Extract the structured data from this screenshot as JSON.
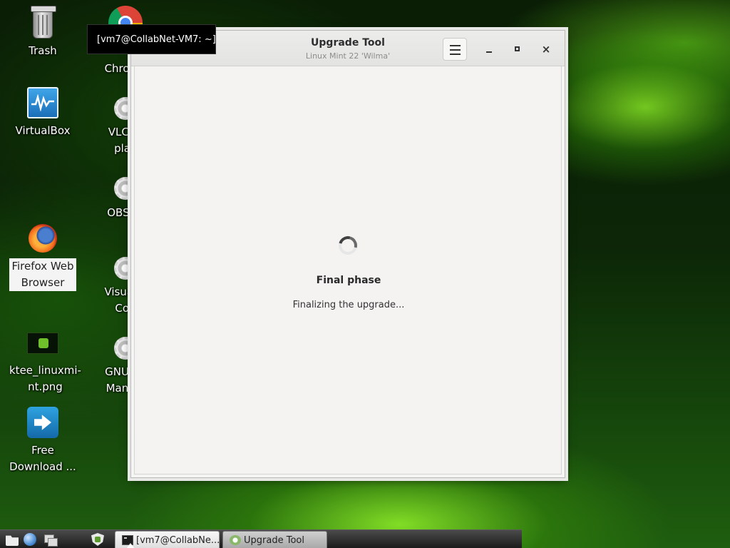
{
  "desktop": {
    "icons": [
      {
        "id": "trash",
        "label": "Trash",
        "icon": "trash-icon"
      },
      {
        "id": "chrome",
        "label": "Chrome",
        "icon": "chrome-icon"
      },
      {
        "id": "virtualbox",
        "label": "VirtualBox",
        "icon": "virtualbox-icon"
      },
      {
        "id": "vlc",
        "label": "VLC m\nplay",
        "icon": "gear-icon"
      },
      {
        "id": "obs",
        "label": "OBS St",
        "icon": "gear-icon"
      },
      {
        "id": "firefox",
        "label": "Firefox Web\nBrowser",
        "icon": "firefox-icon"
      },
      {
        "id": "vscode",
        "label": "Visual S\nCod",
        "icon": "gear-icon"
      },
      {
        "id": "ktee",
        "label": "ktee_linuxmi-\nnt.png",
        "icon": "image-file-icon"
      },
      {
        "id": "gimp",
        "label": "GNU Im\nManipu",
        "icon": "gear-icon"
      },
      {
        "id": "fdm",
        "label": "Free\nDownload ...",
        "icon": "free-download-manager-icon"
      }
    ],
    "tooltip": "[vm7@CollabNet-VM7: ~]"
  },
  "window": {
    "title": "Upgrade Tool",
    "subtitle": "Linux Mint 22 'Wilma'",
    "close_glyph": "×",
    "phase_title": "Final phase",
    "phase_message": "Finalizing the upgrade..."
  },
  "taskbar": {
    "tasks": [
      {
        "label": "[vm7@CollabNe...",
        "active": true
      },
      {
        "label": "Upgrade Tool",
        "active": false
      }
    ]
  },
  "colors": {
    "desktop_green": "#1f5e0f",
    "window_bg": "#f5f5f4",
    "spinner": "#404040"
  }
}
